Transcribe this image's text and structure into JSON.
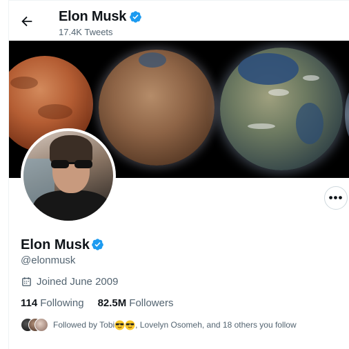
{
  "header": {
    "name": "Elon Musk",
    "tweet_count": "17.4K Tweets"
  },
  "profile": {
    "name": "Elon Musk",
    "handle": "@elonmusk",
    "joined": "Joined June 2009",
    "following_count": "114",
    "following_label": "Following",
    "followers_count": "82.5M",
    "followers_label": "Followers",
    "followed_by_prefix": "Followed by Tobi",
    "followed_by_suffix": ", Lovelyn Osomeh, and 18 others you follow",
    "more_label": "•••"
  },
  "icons": {
    "back": "arrow-left-icon",
    "verified": "verified-badge-icon",
    "calendar": "calendar-icon",
    "more": "more-icon",
    "sunglasses": "sunglasses-emoji-icon"
  },
  "colors": {
    "verified": "#1d9bf0",
    "text": "#0f1419",
    "muted": "#536471",
    "border": "#cfd9de"
  }
}
